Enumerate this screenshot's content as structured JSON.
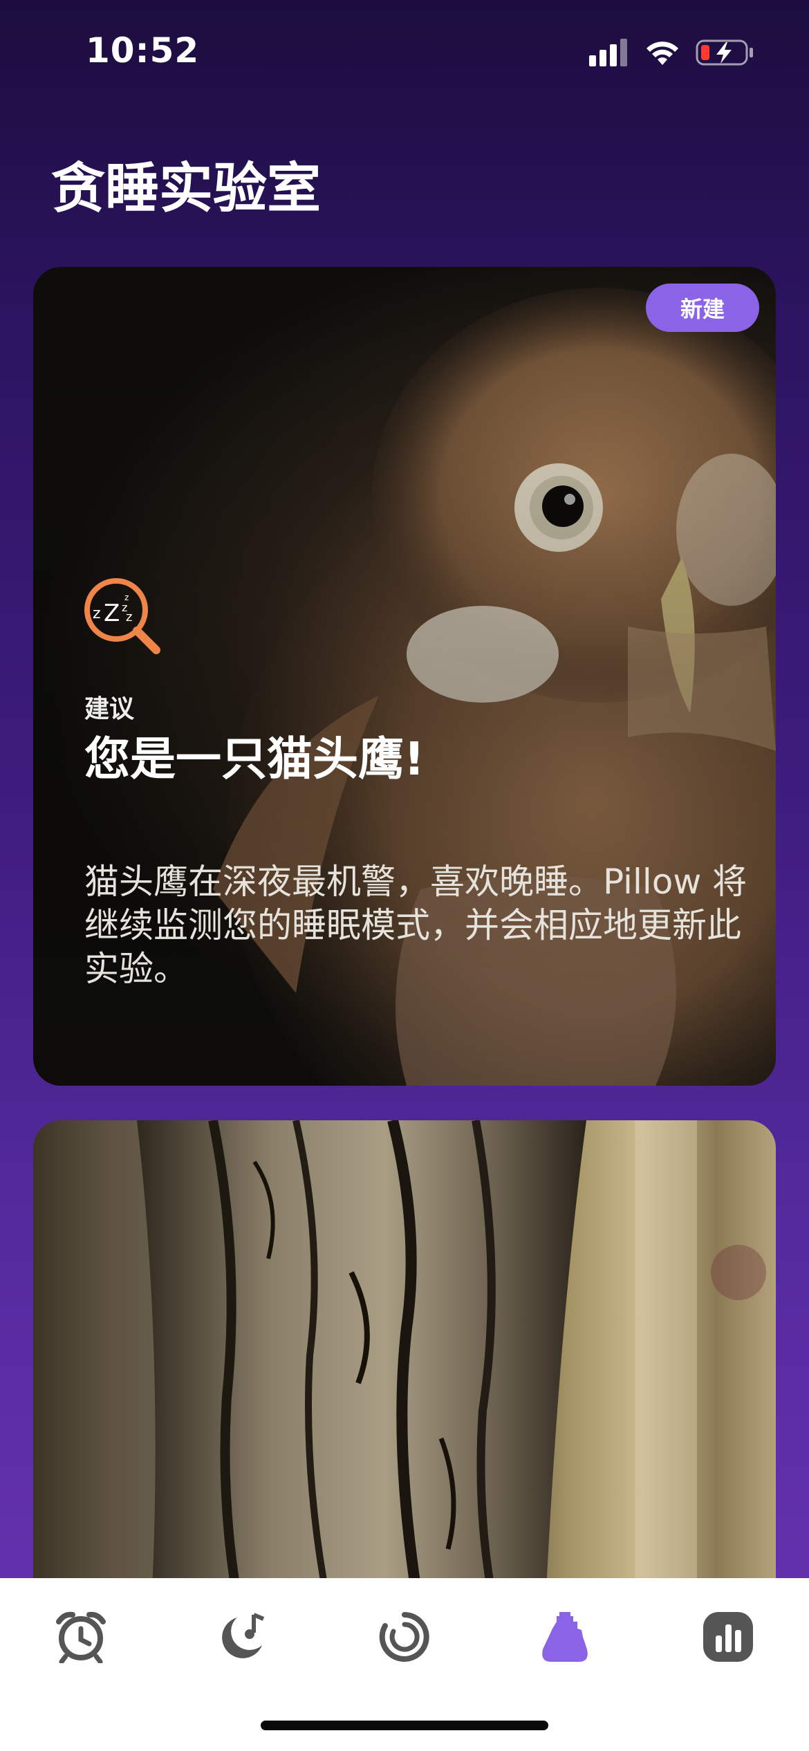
{
  "status_bar": {
    "time": "10:52"
  },
  "page": {
    "title": "贪睡实验室"
  },
  "owl_card": {
    "badge": "新建",
    "kicker": "建议",
    "headline": "您是一只猫头鹰!",
    "body": "猫头鹰在深夜最机警，喜欢晚睡。Pillow 将继续监测您的睡眠模式，并会相应地更新此实验。"
  },
  "tab_bar": {
    "tabs": [
      {
        "icon": "alarm-clock-icon",
        "active": false
      },
      {
        "icon": "moon-note-icon",
        "active": false
      },
      {
        "icon": "progress-ring-icon",
        "active": false
      },
      {
        "icon": "flask-icon",
        "active": true
      },
      {
        "icon": "bar-chart-icon",
        "active": false
      }
    ]
  },
  "colors": {
    "accent": "#8a63e6",
    "tab_inactive": "#555555",
    "icon_orange": "#f0854a"
  }
}
